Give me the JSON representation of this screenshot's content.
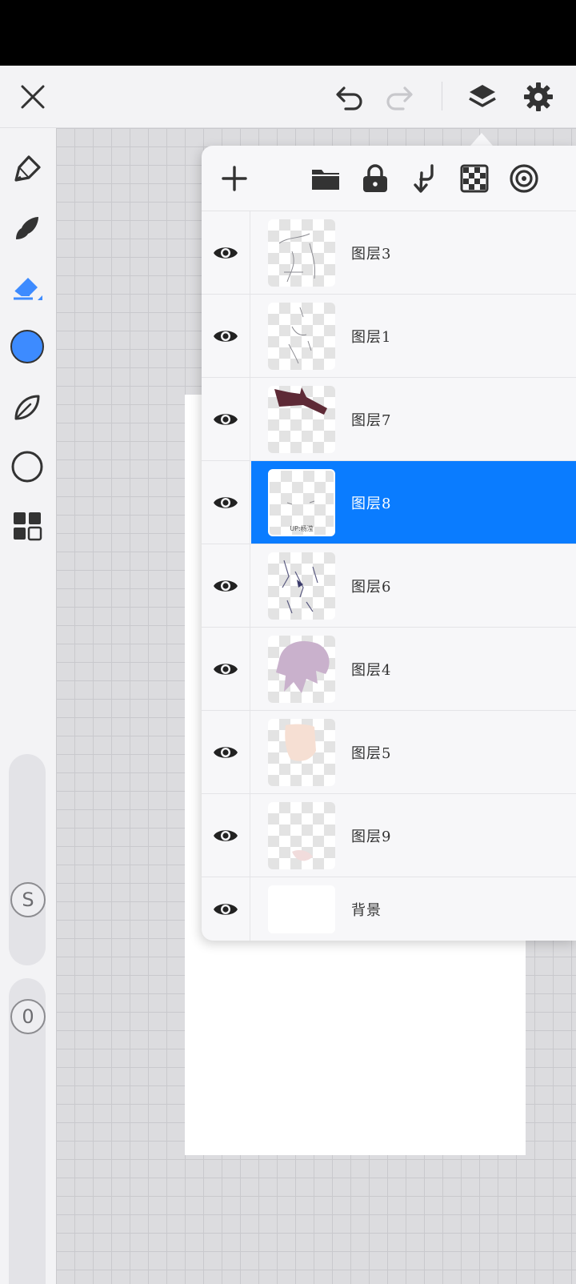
{
  "toolbar": {
    "close_icon": "close-icon",
    "undo_icon": "undo-icon",
    "redo_icon": "redo-icon",
    "layers_icon": "layers-icon",
    "settings_icon": "gear-icon"
  },
  "sidebar": {
    "tools": [
      "pencil-icon",
      "brush-icon",
      "eraser-icon",
      "color-swatch",
      "leaf-icon",
      "circle-shape-icon",
      "grid-icon"
    ],
    "active_color": "#3d8bff",
    "size_slider_label": "S",
    "opacity_slider_label": "0"
  },
  "layers_panel": {
    "actions": [
      "add-icon",
      "folder-icon",
      "lock-icon",
      "merge-down-icon",
      "checkerboard-icon",
      "target-icon"
    ],
    "layers": [
      {
        "name": "图层3",
        "visible": true,
        "selected": false
      },
      {
        "name": "图层1",
        "visible": true,
        "selected": false
      },
      {
        "name": "图层7",
        "visible": true,
        "selected": false
      },
      {
        "name": "图层8",
        "visible": true,
        "selected": true,
        "thumb_caption": "UP:杨滢"
      },
      {
        "name": "图层6",
        "visible": true,
        "selected": false
      },
      {
        "name": "图层4",
        "visible": true,
        "selected": false
      },
      {
        "name": "图层5",
        "visible": true,
        "selected": false
      },
      {
        "name": "图层9",
        "visible": true,
        "selected": false
      },
      {
        "name": "背景",
        "visible": true,
        "selected": false
      }
    ]
  },
  "colors": {
    "accent": "#0a7cff",
    "panel_bg": "#f7f7f9"
  }
}
